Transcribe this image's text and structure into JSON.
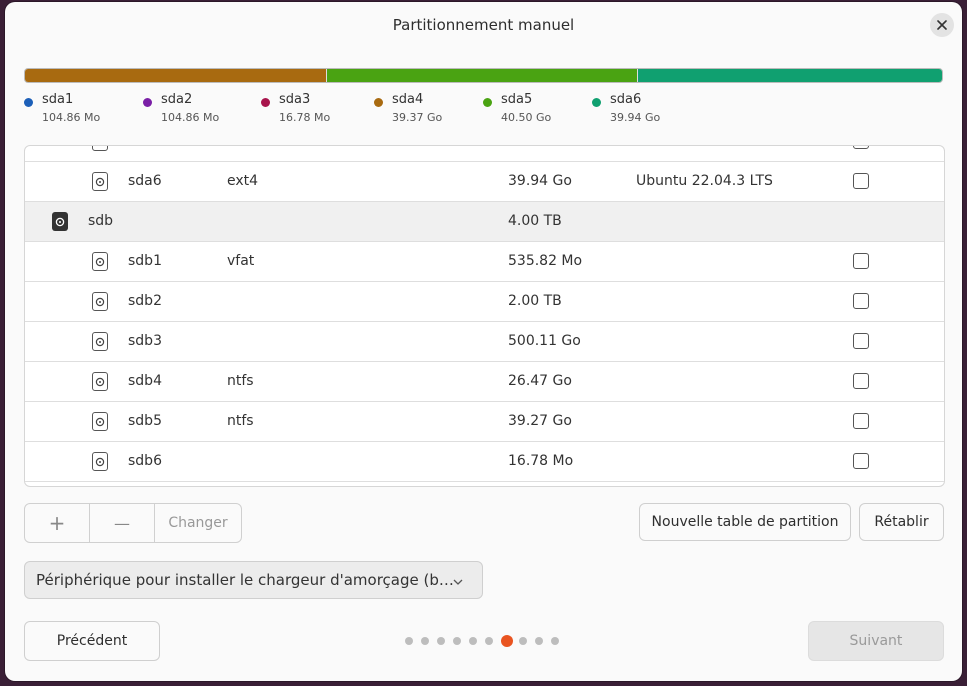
{
  "window": {
    "title": "Partitionnement manuel"
  },
  "colors": {
    "accent": "#e95420",
    "sda1": "#1c5fb8",
    "sda2": "#7a1fa6",
    "sda3": "#a8144c",
    "sda4": "#a86a10",
    "sda5": "#4aa312",
    "sda6": "#10a070"
  },
  "usage_bar": [
    {
      "name": "sda4",
      "color": "#a86a10",
      "fraction": 0.329
    },
    {
      "name": "sda5",
      "color": "#4aa312",
      "fraction": 0.339
    },
    {
      "name": "sda6",
      "color": "#10a070",
      "fraction": 0.332
    }
  ],
  "legend": [
    {
      "name": "sda1",
      "size": "104.86 Mo",
      "color": "#1c5fb8"
    },
    {
      "name": "sda2",
      "size": "104.86 Mo",
      "color": "#7a1fa6"
    },
    {
      "name": "sda3",
      "size": "16.78 Mo",
      "color": "#a8144c"
    },
    {
      "name": "sda4",
      "size": "39.37 Go",
      "color": "#a86a10"
    },
    {
      "name": "sda5",
      "size": "40.50 Go",
      "color": "#4aa312"
    },
    {
      "name": "sda6",
      "size": "39.94 Go",
      "color": "#10a070"
    }
  ],
  "rows": [
    {
      "type": "partition",
      "name": "sda6",
      "fs": "ext4",
      "size": "39.94 Go",
      "system": "Ubuntu 22.04.3 LTS"
    },
    {
      "type": "disk",
      "name": "sdb",
      "fs": "",
      "size": "4.00 TB",
      "system": ""
    },
    {
      "type": "partition",
      "name": "sdb1",
      "fs": "vfat",
      "size": "535.82 Mo",
      "system": ""
    },
    {
      "type": "partition",
      "name": "sdb2",
      "fs": "",
      "size": "2.00 TB",
      "system": ""
    },
    {
      "type": "partition",
      "name": "sdb3",
      "fs": "",
      "size": "500.11 Go",
      "system": ""
    },
    {
      "type": "partition",
      "name": "sdb4",
      "fs": "ntfs",
      "size": "26.47 Go",
      "system": ""
    },
    {
      "type": "partition",
      "name": "sdb5",
      "fs": "ntfs",
      "size": "39.27 Go",
      "system": ""
    },
    {
      "type": "partition",
      "name": "sdb6",
      "fs": "",
      "size": "16.78 Mo",
      "system": ""
    }
  ],
  "toolbar": {
    "add_label": "+",
    "remove_label": "—",
    "change_label": "Changer",
    "new_table_label": "Nouvelle table de partition",
    "reset_label": "Rétablir"
  },
  "bootloader": {
    "value": "Périphérique pour installer le chargeur d'amorçage (boot"
  },
  "footer": {
    "previous_label": "Précédent",
    "next_label": "Suivant",
    "page_count": 10,
    "current_page": 7
  }
}
